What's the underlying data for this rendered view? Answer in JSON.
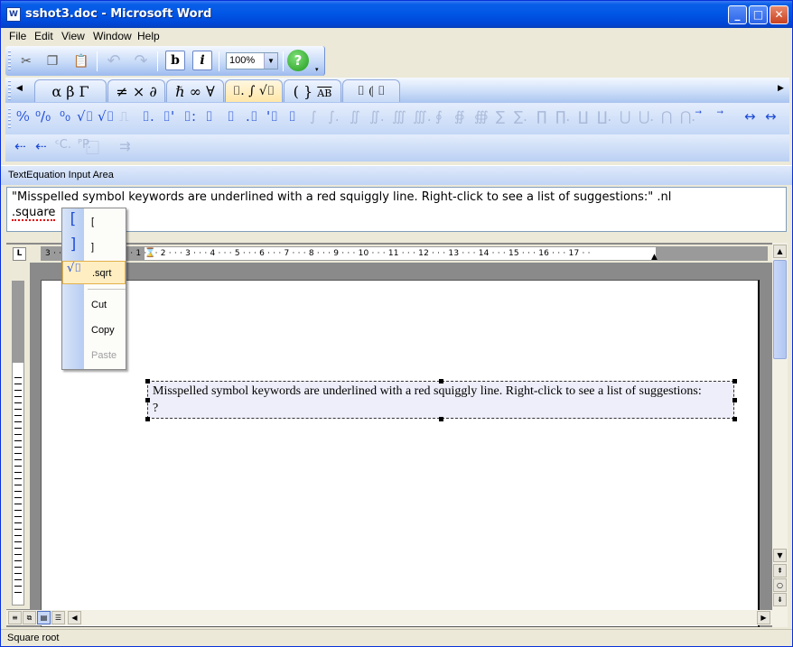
{
  "window": {
    "title": "sshot3.doc - Microsoft Word",
    "icon": "word-doc-icon"
  },
  "menu": [
    "File",
    "Edit",
    "View",
    "Window",
    "Help"
  ],
  "toolbar": {
    "zoom": "100%",
    "bold": "b",
    "italic": "i",
    "help": "?"
  },
  "symbol_tabs": [
    "α β Γ",
    "≠ × ∂",
    "ℏ ∞ ∀",
    "⌷. ∫ √⌷",
    "( }",
    "⌷ ⦇ ⌷"
  ],
  "symbol_tab_ab": "AB",
  "symbol_row1": [
    "⁰⁄₀",
    "⁰/₀",
    "⁰₀",
    "√⌷",
    "√⌷",
    "⎍",
    "⌷.",
    "⌷'",
    "⌷:",
    "⌷",
    "⌷",
    ".⌷",
    "'⌷",
    "⌷",
    "∫",
    "∫.",
    "∬",
    "∬.",
    "∭",
    "∭.",
    "∮",
    "∯",
    "∰",
    "∑",
    "∑.",
    "∏",
    "∏.",
    "∐",
    "∐.",
    "⋃",
    "⋃.",
    "⋂",
    "⋂.",
    "⃗",
    "⃗",
    "↔",
    "↔"
  ],
  "symbol_row2": [
    "⇠",
    "⇠",
    "ᶜC.",
    "ᴾP.",
    "⃞",
    "⇉"
  ],
  "input_area": {
    "label": "TextEquation Input Area",
    "line1": "\"Misspelled symbol keywords are underlined with a red squiggly line. Right-click to see a list of suggestions:\" .nl",
    "line2_keyword": ".square"
  },
  "ruler": {
    "tab_stop": "L",
    "marks": "3 · · · 2 · · · 1 · · ·   · · · 1 · · · 2 · · · 3 · · · 4 · · · 5 · · · 6 · · · 7 · · · 8 · · · 9 · · · 10 · · · 11 · · · 12 · · · 13 · · · 14 · · · 15 · · · 16 · · · 17 · ·"
  },
  "context_menu": {
    "items": [
      {
        "glyph": "[",
        "label": "["
      },
      {
        "glyph": "]",
        "label": "]"
      },
      {
        "glyph": "√⌷",
        "label": ".sqrt"
      }
    ],
    "cut": "Cut",
    "copy": "Copy",
    "paste": "Paste"
  },
  "document": {
    "equation_line1": "Misspelled symbol keywords are underlined with a red squiggly line. Right-click to see a list of suggestions:",
    "equation_line2": "?"
  },
  "status": "Square root"
}
